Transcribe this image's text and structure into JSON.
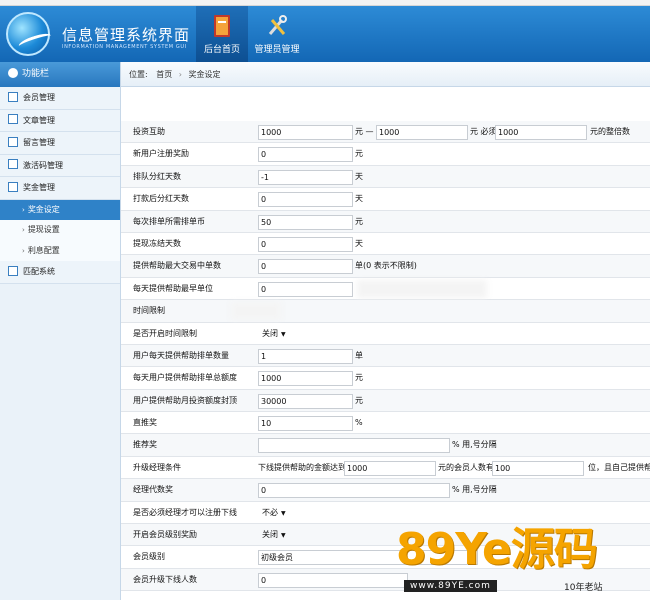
{
  "header": {
    "title": "信息管理系统界面",
    "subtitle": "INFORMATION MANAGEMENT SYSTEM GUI",
    "nav": [
      {
        "label": "后台首页",
        "icon": "book-icon"
      },
      {
        "label": "管理员管理",
        "icon": "tools-icon"
      }
    ]
  },
  "sidebar": {
    "title": "功能栏",
    "items": [
      {
        "label": "会员管理"
      },
      {
        "label": "文章管理"
      },
      {
        "label": "留言管理"
      },
      {
        "label": "激活码管理"
      },
      {
        "label": "奖金管理"
      }
    ],
    "subitems": [
      {
        "label": "奖金设定"
      },
      {
        "label": "提现设置"
      },
      {
        "label": "利息配置"
      }
    ],
    "last_item": {
      "label": "匹配系统"
    }
  },
  "breadcrumb": {
    "prefix": "位置:",
    "home": "首页",
    "current": "奖金设定"
  },
  "form": {
    "r1": {
      "label": "投资互助",
      "v1": "1000",
      "t1": "元 —",
      "v2": "1000",
      "t2": "元 必须",
      "v3": "1000",
      "t3": "元的整倍数"
    },
    "r2": {
      "label": "新用户注册奖励",
      "v1": "0",
      "t1": "元"
    },
    "r3": {
      "label": "排队分红天数",
      "v1": "-1",
      "t1": "天"
    },
    "r4": {
      "label": "打款后分红天数",
      "v1": "0",
      "t1": "天"
    },
    "r5": {
      "label": "每次排单所需排单币",
      "v1": "50",
      "t1": "元"
    },
    "r6": {
      "label": "提现冻结天数",
      "v1": "0",
      "t1": "天"
    },
    "r7": {
      "label": "提供帮助最大交易中单数",
      "v1": "0",
      "t1": "单(0 表示不限制)"
    },
    "r8": {
      "label": "每天提供帮助最早单位",
      "v1": "0"
    },
    "r9": {
      "label": "时间限制"
    },
    "r10": {
      "label": "是否开启时间限制",
      "sel": "关闭"
    },
    "r11": {
      "label": "用户每天提供帮助排单数量",
      "v1": "1",
      "t1": "单"
    },
    "r12": {
      "label": "每天用户提供帮助排单总额度",
      "v1": "1000",
      "t1": "元"
    },
    "r13": {
      "label": "用户提供帮助月投资额度封顶",
      "v1": "30000",
      "t1": "元"
    },
    "r14": {
      "label": "直推奖",
      "v1": "10",
      "t1": "%"
    },
    "r15": {
      "label": "推荐奖",
      "v1": "",
      "t1": "% 用,号分隔"
    },
    "r16": {
      "label": "升级经理条件",
      "t0": "下线提供帮助的金额达到",
      "v1": "1000",
      "t1": "元的会员人数有",
      "v2": "100",
      "t2": "位，且自己提供帮"
    },
    "r17": {
      "label": "经理代数奖",
      "v1": "0",
      "t1": "% 用,号分隔"
    },
    "r18": {
      "label": "是否必须经理才可以注册下线",
      "sel": "不必"
    },
    "r19": {
      "label": "开启会员级别奖励",
      "sel": "关闭"
    },
    "r20": {
      "label": "会员级别",
      "v1": "初级会员"
    },
    "r21": {
      "label": "会员升级下线人数",
      "v1": "0"
    }
  },
  "watermark": {
    "big": "89Ye源码",
    "url": "www.89YE.com",
    "badge": "10年老站"
  }
}
